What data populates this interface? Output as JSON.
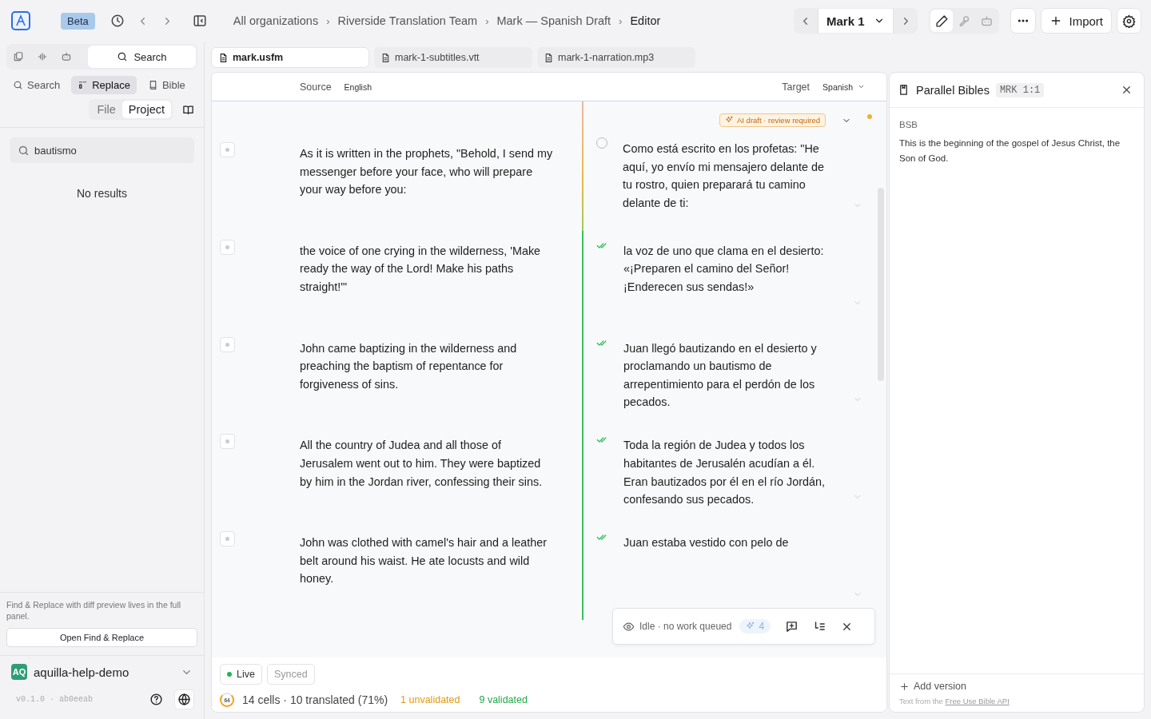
{
  "topbar": {
    "badge": "Beta",
    "separator": "›",
    "breadcrumbs": [
      "All organizations",
      "Riverside Translation Team",
      "Mark — Spanish Draft",
      "Editor"
    ],
    "chapter": "Mark 1",
    "modes": [
      {
        "kind": "pencil",
        "selected": true
      },
      {
        "kind": "voice",
        "selected": false
      },
      {
        "kind": "bot",
        "selected": false
      }
    ],
    "import": "Import"
  },
  "sidebar": {
    "modes": [
      {
        "kind": "files",
        "selected": false
      },
      {
        "kind": "wave",
        "selected": false
      },
      {
        "kind": "bot",
        "selected": false
      }
    ],
    "search_button": "Search",
    "tabs": [
      {
        "label": "Search",
        "kind": "search",
        "selected": false
      },
      {
        "label": "Replace",
        "kind": "replace",
        "selected": true
      },
      {
        "label": "Bible",
        "kind": "book",
        "selected": false
      }
    ],
    "scope": [
      {
        "label": "File",
        "selected": false
      },
      {
        "label": "Project",
        "selected": true
      }
    ],
    "search": {
      "value": "bautismo"
    },
    "empty": "No results",
    "hint": "Find & Replace with diff preview lives in the full panel.",
    "open_button": "Open Find & Replace",
    "workspace": {
      "initials": "AQ",
      "name": "aquilla-help-demo"
    },
    "version": "v0.1.0 · ab0eeab"
  },
  "file_tabs": [
    {
      "label": "mark.usfm",
      "selected": true
    },
    {
      "label": "mark-1-subtitles.vtt",
      "selected": false
    },
    {
      "label": "mark-1-narration.mp3",
      "selected": false
    }
  ],
  "editor": {
    "source_label": "Source",
    "source_lang": "English",
    "target_label": "Target",
    "target_lang": "Spanish",
    "cells": [
      {
        "validated": false,
        "badge": "AI draft · review required",
        "source": "As it is written in the prophets, \"Behold, I send my messenger before your face, who will prepare your way before you:",
        "target": "Como está escrito en los profetas: \"He aquí, yo envío mi mensajero delante de tu rostro, quien preparará tu camino delante de ti:"
      },
      {
        "validated": true,
        "source": "the voice of one crying in the wilderness, 'Make ready the way of the Lord! Make his paths straight!'\"",
        "target": "la voz de uno que clama en el desierto: «¡Preparen el camino del Señor! ¡Enderecen sus sendas!»"
      },
      {
        "validated": true,
        "source": "John came baptizing in the wilderness and preaching the baptism of repentance for forgiveness of sins.",
        "target": "Juan llegó bautizando en el desierto y proclamando un bautismo de arrepentimiento para el perdón de los pecados."
      },
      {
        "validated": true,
        "source": "All the country of Judea and all those of Jerusalem went out to him. They were baptized by him in the Jordan river, confessing their sins.",
        "target": "Toda la región de Judea y todos los habitantes de Jerusalén acudían a él. Eran bautizados por él en el río Jordán, confesando sus pecados."
      },
      {
        "validated": true,
        "source": "John was clothed with camel's hair and a leather belt around his waist. He ate locusts and wild honey.",
        "target": "Juan estaba vestido con pelo de"
      }
    ],
    "queue": {
      "status": "Idle · no work queued",
      "count": "4"
    },
    "chips": [
      {
        "label": "Live",
        "kind": "live"
      },
      {
        "label": "Synced",
        "kind": "synced"
      }
    ],
    "progress": {
      "ring": "64",
      "summary": "14 cells · 10 translated (71%)",
      "unvalidated": "1 unvalidated",
      "validated": "9 validated"
    }
  },
  "bible": {
    "title": "Parallel Bibles",
    "ref": "MRK 1:1",
    "version": "BSB",
    "text": "This is the beginning of the gospel of Jesus Christ, the Son of God.",
    "add": "Add version",
    "credit": "Text from the",
    "credit_link": "Free Use Bible API"
  }
}
